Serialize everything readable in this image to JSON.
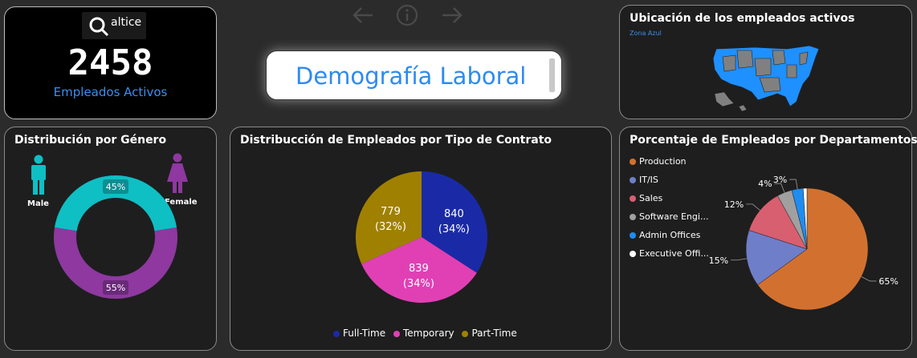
{
  "nav": {
    "back_icon": "arrow-left-icon",
    "info_icon": "info-icon",
    "forward_icon": "arrow-right-icon"
  },
  "kpi": {
    "logo_text": "altice",
    "value": "2458",
    "label": "Empleados Activos"
  },
  "title": {
    "text": "Demografía Laboral"
  },
  "map": {
    "title": "Ubicación de los empleados activos",
    "subtitle": "Zona Azul",
    "highlight_color": "#1e90ff",
    "other_color": "#808080"
  },
  "gender": {
    "title": "Distribución por Género",
    "male_label": "Male",
    "female_label": "Female",
    "chart_data": {
      "type": "pie",
      "labels": [
        "Male",
        "Female"
      ],
      "values": [
        45,
        55
      ],
      "data_labels": [
        "45%",
        "55%"
      ],
      "colors": [
        "#0ebfc4",
        "#8e38a0"
      ]
    }
  },
  "contract": {
    "title": "Distribucción de Empleados por Tipo de Contrato",
    "chart_data": {
      "type": "pie",
      "labels": [
        "Full-Time",
        "Temporary",
        "Part-Time"
      ],
      "values": [
        840,
        839,
        779
      ],
      "percents": [
        "(34%)",
        "(34%)",
        "(32%)"
      ],
      "colors": [
        "#1a2aa6",
        "#e040b4",
        "#a08000"
      ]
    }
  },
  "dept": {
    "title": "Porcentaje de Empleados por Departamentos",
    "chart_data": {
      "type": "pie",
      "labels": [
        "Production",
        "IT/IS",
        "Sales",
        "Software Engi...",
        "Admin Offices",
        "Executive Offi..."
      ],
      "values": [
        65,
        15,
        12,
        4,
        3,
        1
      ],
      "data_labels": [
        "65%",
        "15%",
        "12%",
        "4%",
        "3%",
        ""
      ],
      "colors": [
        "#d2712f",
        "#6f7ec9",
        "#d85f6f",
        "#a0a0a0",
        "#1e8cf0",
        "#ffffff"
      ]
    }
  }
}
